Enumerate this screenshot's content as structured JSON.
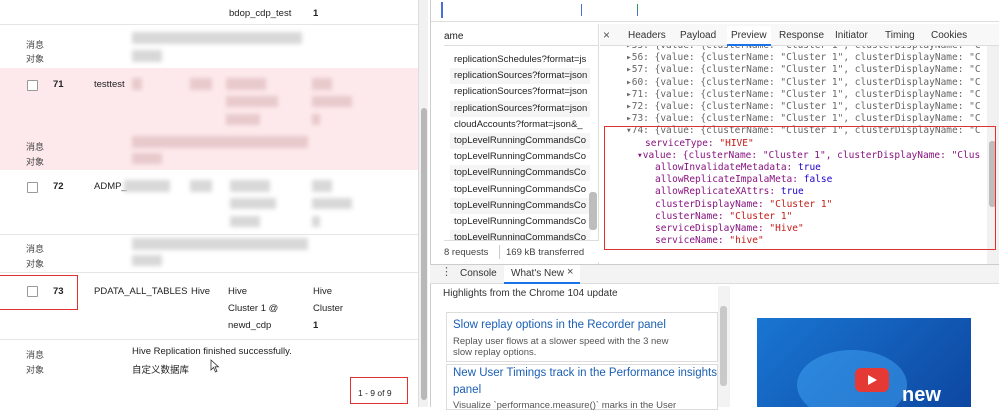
{
  "table": {
    "top_row": {
      "queue": "bdop_cdp_test",
      "count": "1"
    },
    "rows": [
      {
        "id": "71",
        "name": "testtest",
        "msg_label": "消息",
        "obj_label": "对象"
      },
      {
        "id": "72",
        "name": "ADMP_",
        "msg_label": "消息",
        "obj_label": "对象"
      },
      {
        "id": "73",
        "name": "PDATA_ALL_TABLES",
        "type": "Hive",
        "col3": [
          "Hive",
          "Cluster 1 @",
          "newd_cdp"
        ],
        "col4": [
          "Hive",
          "Cluster",
          "1"
        ],
        "msg_label": "消息",
        "obj_label": "对象",
        "message": "Hive Replication finished successfully.",
        "object": "自定义数据库"
      }
    ],
    "first_msg_label": "消息",
    "first_obj_label": "对象",
    "pagination": "1 - 9 of 9"
  },
  "network": {
    "column_header": "ame",
    "requests": [
      "replicationSchedules?format=js",
      "replicationSources?format=json",
      "replicationSources?format=json",
      "replicationSources?format=json",
      "cloudAccounts?format=json&_",
      "topLevelRunningCommandsCo",
      "topLevelRunningCommandsCo",
      "topLevelRunningCommandsCo",
      "topLevelRunningCommandsCo",
      "topLevelRunningCommandsCo",
      "topLevelRunningCommandsCo",
      "topLevelRunningCommandsCo"
    ],
    "status_requests": "8 requests",
    "status_transferred": "169 kB transferred"
  },
  "detail_tabs": [
    "Headers",
    "Payload",
    "Preview",
    "Response",
    "Initiator",
    "Timing",
    "Cookies"
  ],
  "active_tab": "Preview",
  "preview": {
    "collapsed_lines": [
      "▸55: {value: {clusterName: \"Cluster 1\", clusterDisplayName: \"C",
      "▸56: {value: {clusterName: \"Cluster 1\", clusterDisplayName: \"C",
      "▸57: {value: {clusterName: \"Cluster 1\", clusterDisplayName: \"C",
      "▸60: {value: {clusterName: \"Cluster 1\", clusterDisplayName: \"C",
      "▸71: {value: {clusterName: \"Cluster 1\", clusterDisplayName: \"C",
      "▸72: {value: {clusterName: \"Cluster 1\", clusterDisplayName: \"C",
      "▸73: {value: {clusterName: \"Cluster 1\", clusterDisplayName: \"C"
    ],
    "expanded_head": "▾74: {value: {clusterName: \"Cluster 1\", clusterDisplayName: \"C",
    "service_type_key": "serviceType:",
    "service_type_val": "\"HIVE\"",
    "value_head": "▾value: {clusterName: \"Cluster 1\", clusterDisplayName: \"Clus",
    "props": [
      {
        "k": "allowInvalidateMetadata:",
        "v": "true",
        "t": "n"
      },
      {
        "k": "allowReplicateImpalaMeta:",
        "v": "false",
        "t": "n"
      },
      {
        "k": "allowReplicateXAttrs:",
        "v": "true",
        "t": "n"
      },
      {
        "k": "clusterDisplayName:",
        "v": "\"Cluster 1\"",
        "t": "s"
      },
      {
        "k": "clusterName:",
        "v": "\"Cluster 1\"",
        "t": "s"
      },
      {
        "k": "serviceDisplayName:",
        "v": "\"Hive\"",
        "t": "s"
      },
      {
        "k": "serviceName:",
        "v": "\"hive\"",
        "t": "s"
      }
    ]
  },
  "drawer": {
    "tabs": [
      "Console",
      "What's New"
    ],
    "active": "What's New",
    "heading": "Highlights from the Chrome 104 update",
    "cards": [
      {
        "title": "Slow replay options in the Recorder panel",
        "desc1": "Replay user flows at a slower speed with the 3 new",
        "desc2": "slow replay options."
      },
      {
        "title": "New User Timings track in the Performance insights",
        "title2": "panel",
        "desc1": "Visualize `performance.measure()` marks in the User"
      }
    ],
    "video_word": "new"
  },
  "colors": {
    "accent_red": "#e23030",
    "link_blue": "#1a5fb4",
    "tab_active": "#1a73e8",
    "pink_row": "#fde9eb"
  }
}
